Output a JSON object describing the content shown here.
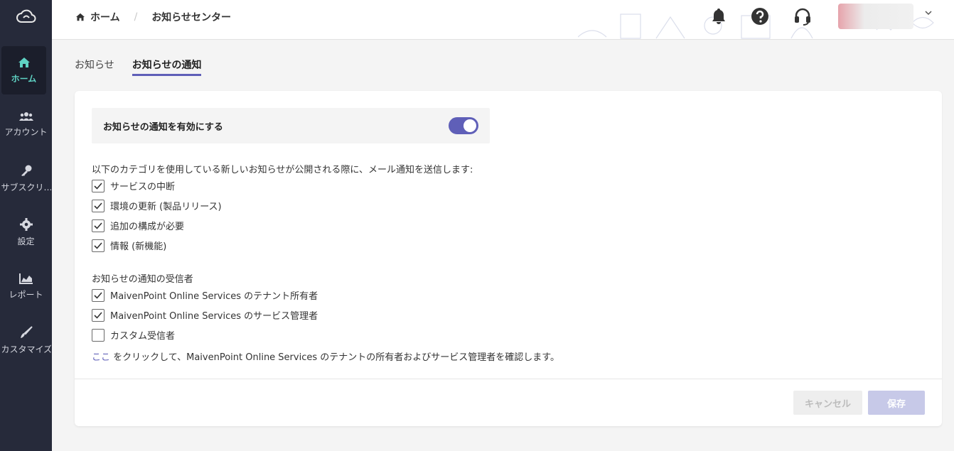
{
  "sidebar": {
    "items": [
      {
        "label": "ホーム",
        "icon": "home-icon",
        "active": true
      },
      {
        "label": "アカウント",
        "icon": "users-icon"
      },
      {
        "label": "サブスクリ…",
        "icon": "key-icon"
      },
      {
        "label": "設定",
        "icon": "gear-icon"
      },
      {
        "label": "レポート",
        "icon": "chart-icon"
      },
      {
        "label": "カスタマイズ",
        "icon": "brush-icon"
      }
    ]
  },
  "header": {
    "breadcrumb": {
      "home": "ホーム",
      "separator": "/",
      "current": "お知らせセンター"
    }
  },
  "tabs": [
    {
      "label": "お知らせ"
    },
    {
      "label": "お知らせの通知",
      "active": true
    }
  ],
  "settings": {
    "enable_label": "お知らせの通知を有効にする",
    "enabled": true,
    "intro": "以下のカテゴリを使用している新しいお知らせが公開される際に、メール通知を送信します:",
    "categories": [
      {
        "label": "サービスの中断",
        "checked": true
      },
      {
        "label": "環境の更新 (製品リリース)",
        "checked": true
      },
      {
        "label": "追加の構成が必要",
        "checked": true
      },
      {
        "label": "情報 (新機能)",
        "checked": true
      }
    ],
    "recipients_title": "お知らせの通知の受信者",
    "recipients": [
      {
        "label": "MaivenPoint Online Services のテナント所有者",
        "checked": true
      },
      {
        "label": "MaivenPoint Online Services のサービス管理者",
        "checked": true
      },
      {
        "label": "カスタム受信者",
        "checked": false
      }
    ],
    "footnote_link": "ここ",
    "footnote_text": " をクリックして、MaivenPoint Online Services のテナントの所有者およびサービス管理者を確認します。"
  },
  "buttons": {
    "cancel": "キャンセル",
    "save": "保存"
  },
  "colors": {
    "accent": "#5f5fb8",
    "sidebar_bg": "#262a3a",
    "active_nav": "#5fd3c4"
  }
}
